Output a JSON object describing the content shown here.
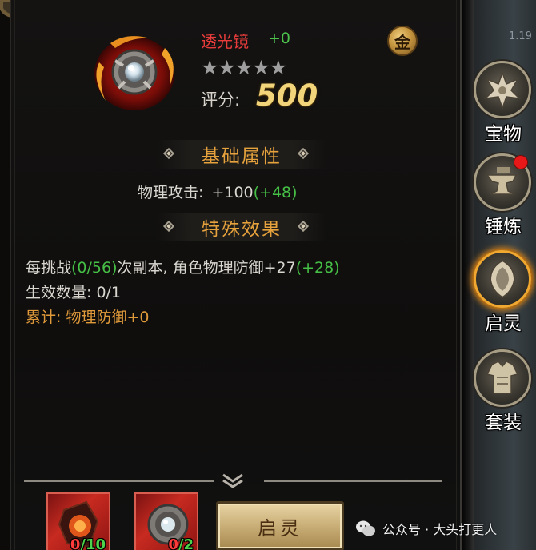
{
  "item": {
    "name": "透光镜",
    "plus": "+0",
    "grade_badge": "金",
    "stars": "★★★★★",
    "score_label": "评分:",
    "score_value": "500"
  },
  "sections": {
    "basic": {
      "title": "基础属性",
      "lines": [
        {
          "label": "物理攻击:",
          "value": "+100",
          "bonus": "(+48)"
        }
      ]
    },
    "special": {
      "title": "特殊效果",
      "line1_a": "每挑战",
      "line1_progress": "(0/56)",
      "line1_b": "次副本, 角色物理防御+27",
      "line1_bonus": "(+28)",
      "line2": "生效数量: 0/1",
      "line3": "累计: 物理防御+0"
    }
  },
  "side_menu": [
    {
      "label": "宝物",
      "icon": "treasure-emblem-icon",
      "active": false,
      "has_dot": false
    },
    {
      "label": "锤炼",
      "icon": "anvil-icon",
      "active": false,
      "has_dot": true
    },
    {
      "label": "启灵",
      "icon": "spirit-shield-icon",
      "active": true,
      "has_dot": false
    },
    {
      "label": "套装",
      "icon": "armor-set-icon",
      "active": false,
      "has_dot": false
    }
  ],
  "top_corner_number": "1.19",
  "materials": [
    {
      "owned": "0",
      "required": "/10"
    },
    {
      "owned": "0",
      "required": "/2"
    }
  ],
  "awaken_button": "启灵",
  "watermark": "公众号 · 大头打更人",
  "colors": {
    "name_red": "#e83c3c",
    "bonus_green": "#45bf45",
    "section_orange": "#e6a23c",
    "score_gold": "#f2d57a"
  }
}
